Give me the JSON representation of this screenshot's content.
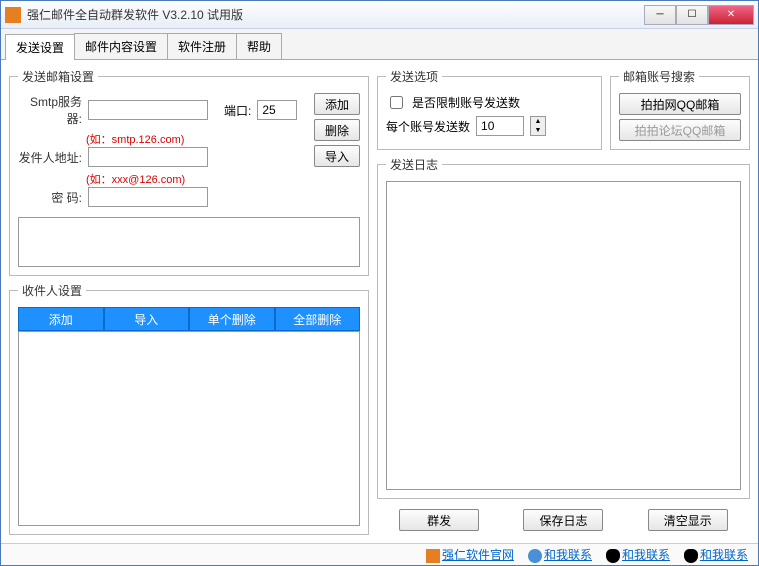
{
  "title": "强仁邮件全自动群发软件 V3.2.10 试用版",
  "tabs": [
    "发送设置",
    "邮件内容设置",
    "软件注册",
    "帮助"
  ],
  "smtp": {
    "legend": "发送邮箱设置",
    "server_label": "Smtp服务器:",
    "server_value": "",
    "server_hint": "(如：smtp.126.com)",
    "port_label": "端口:",
    "port_value": "25",
    "sender_label": "发件人地址:",
    "sender_value": "",
    "sender_hint": "(如：xxx@126.com)",
    "pwd_label": "密    码:",
    "pwd_value": "",
    "btn_add": "添加",
    "btn_del": "删除",
    "btn_import": "导入"
  },
  "recipient": {
    "legend": "收件人设置",
    "btns": [
      "添加",
      "导入",
      "单个删除",
      "全部删除"
    ]
  },
  "options": {
    "legend": "发送选项",
    "limit_label": "是否限制账号发送数",
    "limit_checked": false,
    "per_label": "每个账号发送数",
    "per_value": "10"
  },
  "search": {
    "legend": "邮箱账号搜索",
    "btn1": "拍拍网QQ邮箱",
    "btn2": "拍拍论坛QQ邮箱"
  },
  "log": {
    "legend": "发送日志"
  },
  "actions": {
    "send": "群发",
    "save": "保存日志",
    "clear": "清空显示"
  },
  "footer": {
    "l1": "强仁软件官网",
    "l2": "和我联系",
    "l3": "和我联系",
    "l4": "和我联系"
  }
}
